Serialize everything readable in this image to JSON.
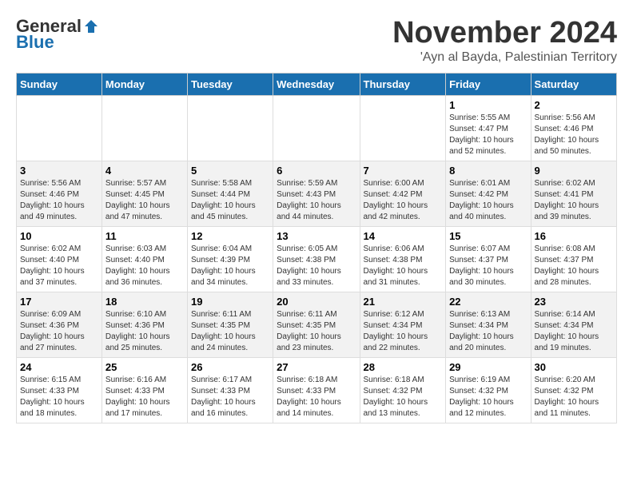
{
  "logo": {
    "general": "General",
    "blue": "Blue"
  },
  "title": "November 2024",
  "location": "'Ayn al Bayda, Palestinian Territory",
  "days_header": [
    "Sunday",
    "Monday",
    "Tuesday",
    "Wednesday",
    "Thursday",
    "Friday",
    "Saturday"
  ],
  "weeks": [
    [
      {
        "day": "",
        "info": ""
      },
      {
        "day": "",
        "info": ""
      },
      {
        "day": "",
        "info": ""
      },
      {
        "day": "",
        "info": ""
      },
      {
        "day": "",
        "info": ""
      },
      {
        "day": "1",
        "info": "Sunrise: 5:55 AM\nSunset: 4:47 PM\nDaylight: 10 hours\nand 52 minutes."
      },
      {
        "day": "2",
        "info": "Sunrise: 5:56 AM\nSunset: 4:46 PM\nDaylight: 10 hours\nand 50 minutes."
      }
    ],
    [
      {
        "day": "3",
        "info": "Sunrise: 5:56 AM\nSunset: 4:46 PM\nDaylight: 10 hours\nand 49 minutes."
      },
      {
        "day": "4",
        "info": "Sunrise: 5:57 AM\nSunset: 4:45 PM\nDaylight: 10 hours\nand 47 minutes."
      },
      {
        "day": "5",
        "info": "Sunrise: 5:58 AM\nSunset: 4:44 PM\nDaylight: 10 hours\nand 45 minutes."
      },
      {
        "day": "6",
        "info": "Sunrise: 5:59 AM\nSunset: 4:43 PM\nDaylight: 10 hours\nand 44 minutes."
      },
      {
        "day": "7",
        "info": "Sunrise: 6:00 AM\nSunset: 4:42 PM\nDaylight: 10 hours\nand 42 minutes."
      },
      {
        "day": "8",
        "info": "Sunrise: 6:01 AM\nSunset: 4:42 PM\nDaylight: 10 hours\nand 40 minutes."
      },
      {
        "day": "9",
        "info": "Sunrise: 6:02 AM\nSunset: 4:41 PM\nDaylight: 10 hours\nand 39 minutes."
      }
    ],
    [
      {
        "day": "10",
        "info": "Sunrise: 6:02 AM\nSunset: 4:40 PM\nDaylight: 10 hours\nand 37 minutes."
      },
      {
        "day": "11",
        "info": "Sunrise: 6:03 AM\nSunset: 4:40 PM\nDaylight: 10 hours\nand 36 minutes."
      },
      {
        "day": "12",
        "info": "Sunrise: 6:04 AM\nSunset: 4:39 PM\nDaylight: 10 hours\nand 34 minutes."
      },
      {
        "day": "13",
        "info": "Sunrise: 6:05 AM\nSunset: 4:38 PM\nDaylight: 10 hours\nand 33 minutes."
      },
      {
        "day": "14",
        "info": "Sunrise: 6:06 AM\nSunset: 4:38 PM\nDaylight: 10 hours\nand 31 minutes."
      },
      {
        "day": "15",
        "info": "Sunrise: 6:07 AM\nSunset: 4:37 PM\nDaylight: 10 hours\nand 30 minutes."
      },
      {
        "day": "16",
        "info": "Sunrise: 6:08 AM\nSunset: 4:37 PM\nDaylight: 10 hours\nand 28 minutes."
      }
    ],
    [
      {
        "day": "17",
        "info": "Sunrise: 6:09 AM\nSunset: 4:36 PM\nDaylight: 10 hours\nand 27 minutes."
      },
      {
        "day": "18",
        "info": "Sunrise: 6:10 AM\nSunset: 4:36 PM\nDaylight: 10 hours\nand 25 minutes."
      },
      {
        "day": "19",
        "info": "Sunrise: 6:11 AM\nSunset: 4:35 PM\nDaylight: 10 hours\nand 24 minutes."
      },
      {
        "day": "20",
        "info": "Sunrise: 6:11 AM\nSunset: 4:35 PM\nDaylight: 10 hours\nand 23 minutes."
      },
      {
        "day": "21",
        "info": "Sunrise: 6:12 AM\nSunset: 4:34 PM\nDaylight: 10 hours\nand 22 minutes."
      },
      {
        "day": "22",
        "info": "Sunrise: 6:13 AM\nSunset: 4:34 PM\nDaylight: 10 hours\nand 20 minutes."
      },
      {
        "day": "23",
        "info": "Sunrise: 6:14 AM\nSunset: 4:34 PM\nDaylight: 10 hours\nand 19 minutes."
      }
    ],
    [
      {
        "day": "24",
        "info": "Sunrise: 6:15 AM\nSunset: 4:33 PM\nDaylight: 10 hours\nand 18 minutes."
      },
      {
        "day": "25",
        "info": "Sunrise: 6:16 AM\nSunset: 4:33 PM\nDaylight: 10 hours\nand 17 minutes."
      },
      {
        "day": "26",
        "info": "Sunrise: 6:17 AM\nSunset: 4:33 PM\nDaylight: 10 hours\nand 16 minutes."
      },
      {
        "day": "27",
        "info": "Sunrise: 6:18 AM\nSunset: 4:33 PM\nDaylight: 10 hours\nand 14 minutes."
      },
      {
        "day": "28",
        "info": "Sunrise: 6:18 AM\nSunset: 4:32 PM\nDaylight: 10 hours\nand 13 minutes."
      },
      {
        "day": "29",
        "info": "Sunrise: 6:19 AM\nSunset: 4:32 PM\nDaylight: 10 hours\nand 12 minutes."
      },
      {
        "day": "30",
        "info": "Sunrise: 6:20 AM\nSunset: 4:32 PM\nDaylight: 10 hours\nand 11 minutes."
      }
    ]
  ]
}
